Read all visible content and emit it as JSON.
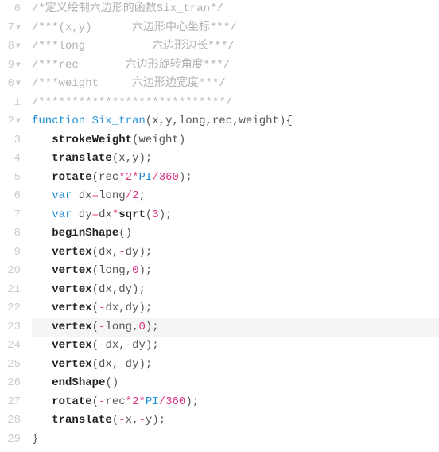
{
  "gutter": {
    "lines": [
      "6",
      "7",
      "8",
      "9",
      "0",
      "1",
      "2",
      "3",
      "4",
      "5",
      "6",
      "7",
      "8",
      "9",
      "20",
      "21",
      "22",
      "23",
      "24",
      "25",
      "26",
      "27",
      "28",
      "29"
    ],
    "foldable": [
      1,
      2,
      3,
      4,
      6
    ]
  },
  "code": {
    "lines": [
      {
        "tokens": [
          {
            "t": "comment",
            "v": "/*定义绘制六边形的函数Six_tran*/"
          }
        ]
      },
      {
        "tokens": [
          {
            "t": "comment",
            "v": "/***(x,y)      六边形中心坐标***/"
          }
        ]
      },
      {
        "tokens": [
          {
            "t": "comment",
            "v": "/***long          六边形边长***/"
          }
        ]
      },
      {
        "tokens": [
          {
            "t": "comment",
            "v": "/***rec       六边形旋转角度***/"
          }
        ]
      },
      {
        "tokens": [
          {
            "t": "comment",
            "v": "/***weight     六边形边宽度***/"
          }
        ]
      },
      {
        "tokens": [
          {
            "t": "comment",
            "v": "/****************************/"
          }
        ]
      },
      {
        "tokens": [
          {
            "t": "keyword",
            "v": "function"
          },
          {
            "t": "plain",
            "v": " "
          },
          {
            "t": "funcname",
            "v": "Six_tran"
          },
          {
            "t": "paren",
            "v": "("
          },
          {
            "t": "var",
            "v": "x"
          },
          {
            "t": "plain",
            "v": ","
          },
          {
            "t": "var",
            "v": "y"
          },
          {
            "t": "plain",
            "v": ","
          },
          {
            "t": "var",
            "v": "long"
          },
          {
            "t": "plain",
            "v": ","
          },
          {
            "t": "var",
            "v": "rec"
          },
          {
            "t": "plain",
            "v": ","
          },
          {
            "t": "var",
            "v": "weight"
          },
          {
            "t": "paren",
            "v": ")"
          },
          {
            "t": "brace",
            "v": "{"
          }
        ]
      },
      {
        "indent": 1,
        "tokens": [
          {
            "t": "funccall",
            "v": "strokeWeight"
          },
          {
            "t": "paren",
            "v": "("
          },
          {
            "t": "var",
            "v": "weight"
          },
          {
            "t": "paren",
            "v": ")"
          }
        ]
      },
      {
        "indent": 1,
        "tokens": [
          {
            "t": "funccall",
            "v": "translate"
          },
          {
            "t": "paren",
            "v": "("
          },
          {
            "t": "var",
            "v": "x"
          },
          {
            "t": "plain",
            "v": ","
          },
          {
            "t": "var",
            "v": "y"
          },
          {
            "t": "paren",
            "v": ")"
          },
          {
            "t": "plain",
            "v": ";"
          }
        ]
      },
      {
        "indent": 1,
        "tokens": [
          {
            "t": "funccall",
            "v": "rotate"
          },
          {
            "t": "paren",
            "v": "("
          },
          {
            "t": "var",
            "v": "rec"
          },
          {
            "t": "operator",
            "v": "*"
          },
          {
            "t": "number",
            "v": "2"
          },
          {
            "t": "operator",
            "v": "*"
          },
          {
            "t": "const",
            "v": "PI"
          },
          {
            "t": "operator",
            "v": "/"
          },
          {
            "t": "number",
            "v": "360"
          },
          {
            "t": "paren",
            "v": ")"
          },
          {
            "t": "plain",
            "v": ";"
          }
        ]
      },
      {
        "indent": 1,
        "tokens": [
          {
            "t": "keyword",
            "v": "var"
          },
          {
            "t": "plain",
            "v": " "
          },
          {
            "t": "var",
            "v": "dx"
          },
          {
            "t": "operator",
            "v": "="
          },
          {
            "t": "var",
            "v": "long"
          },
          {
            "t": "operator",
            "v": "/"
          },
          {
            "t": "number",
            "v": "2"
          },
          {
            "t": "plain",
            "v": ";"
          }
        ]
      },
      {
        "indent": 1,
        "tokens": [
          {
            "t": "keyword",
            "v": "var"
          },
          {
            "t": "plain",
            "v": " "
          },
          {
            "t": "var",
            "v": "dy"
          },
          {
            "t": "operator",
            "v": "="
          },
          {
            "t": "var",
            "v": "dx"
          },
          {
            "t": "operator",
            "v": "*"
          },
          {
            "t": "funccall",
            "v": "sqrt"
          },
          {
            "t": "paren",
            "v": "("
          },
          {
            "t": "number",
            "v": "3"
          },
          {
            "t": "paren",
            "v": ")"
          },
          {
            "t": "plain",
            "v": ";"
          }
        ]
      },
      {
        "indent": 1,
        "tokens": [
          {
            "t": "funccall",
            "v": "beginShape"
          },
          {
            "t": "paren",
            "v": "()"
          }
        ]
      },
      {
        "indent": 1,
        "tokens": [
          {
            "t": "funccall",
            "v": "vertex"
          },
          {
            "t": "paren",
            "v": "("
          },
          {
            "t": "var",
            "v": "dx"
          },
          {
            "t": "plain",
            "v": ","
          },
          {
            "t": "operator",
            "v": "-"
          },
          {
            "t": "var",
            "v": "dy"
          },
          {
            "t": "paren",
            "v": ")"
          },
          {
            "t": "plain",
            "v": ";"
          }
        ]
      },
      {
        "indent": 1,
        "tokens": [
          {
            "t": "funccall",
            "v": "vertex"
          },
          {
            "t": "paren",
            "v": "("
          },
          {
            "t": "var",
            "v": "long"
          },
          {
            "t": "plain",
            "v": ","
          },
          {
            "t": "number",
            "v": "0"
          },
          {
            "t": "paren",
            "v": ")"
          },
          {
            "t": "plain",
            "v": ";"
          }
        ]
      },
      {
        "indent": 1,
        "tokens": [
          {
            "t": "funccall",
            "v": "vertex"
          },
          {
            "t": "paren",
            "v": "("
          },
          {
            "t": "var",
            "v": "dx"
          },
          {
            "t": "plain",
            "v": ","
          },
          {
            "t": "var",
            "v": "dy"
          },
          {
            "t": "paren",
            "v": ")"
          },
          {
            "t": "plain",
            "v": ";"
          }
        ]
      },
      {
        "indent": 1,
        "tokens": [
          {
            "t": "funccall",
            "v": "vertex"
          },
          {
            "t": "paren",
            "v": "("
          },
          {
            "t": "operator",
            "v": "-"
          },
          {
            "t": "var",
            "v": "dx"
          },
          {
            "t": "plain",
            "v": ","
          },
          {
            "t": "var",
            "v": "dy"
          },
          {
            "t": "paren",
            "v": ")"
          },
          {
            "t": "plain",
            "v": ";"
          }
        ]
      },
      {
        "indent": 1,
        "highlighted": true,
        "tokens": [
          {
            "t": "funccall",
            "v": "vertex"
          },
          {
            "t": "paren",
            "v": "("
          },
          {
            "t": "operator",
            "v": "-"
          },
          {
            "t": "var",
            "v": "long"
          },
          {
            "t": "plain",
            "v": ","
          },
          {
            "t": "number",
            "v": "0"
          },
          {
            "t": "paren",
            "v": ")"
          },
          {
            "t": "plain",
            "v": ";"
          }
        ]
      },
      {
        "indent": 1,
        "tokens": [
          {
            "t": "funccall",
            "v": "vertex"
          },
          {
            "t": "paren",
            "v": "("
          },
          {
            "t": "operator",
            "v": "-"
          },
          {
            "t": "var",
            "v": "dx"
          },
          {
            "t": "plain",
            "v": ","
          },
          {
            "t": "operator",
            "v": "-"
          },
          {
            "t": "var",
            "v": "dy"
          },
          {
            "t": "paren",
            "v": ")"
          },
          {
            "t": "plain",
            "v": ";"
          }
        ]
      },
      {
        "indent": 1,
        "tokens": [
          {
            "t": "funccall",
            "v": "vertex"
          },
          {
            "t": "paren",
            "v": "("
          },
          {
            "t": "var",
            "v": "dx"
          },
          {
            "t": "plain",
            "v": ","
          },
          {
            "t": "operator",
            "v": "-"
          },
          {
            "t": "var",
            "v": "dy"
          },
          {
            "t": "paren",
            "v": ")"
          },
          {
            "t": "plain",
            "v": ";"
          }
        ]
      },
      {
        "indent": 1,
        "tokens": [
          {
            "t": "funccall",
            "v": "endShape"
          },
          {
            "t": "paren",
            "v": "()"
          }
        ]
      },
      {
        "indent": 1,
        "tokens": [
          {
            "t": "funccall",
            "v": "rotate"
          },
          {
            "t": "paren",
            "v": "("
          },
          {
            "t": "operator",
            "v": "-"
          },
          {
            "t": "var",
            "v": "rec"
          },
          {
            "t": "operator",
            "v": "*"
          },
          {
            "t": "number",
            "v": "2"
          },
          {
            "t": "operator",
            "v": "*"
          },
          {
            "t": "const",
            "v": "PI"
          },
          {
            "t": "operator",
            "v": "/"
          },
          {
            "t": "number",
            "v": "360"
          },
          {
            "t": "paren",
            "v": ")"
          },
          {
            "t": "plain",
            "v": ";"
          }
        ]
      },
      {
        "indent": 1,
        "tokens": [
          {
            "t": "funccall",
            "v": "translate"
          },
          {
            "t": "paren",
            "v": "("
          },
          {
            "t": "operator",
            "v": "-"
          },
          {
            "t": "var",
            "v": "x"
          },
          {
            "t": "plain",
            "v": ","
          },
          {
            "t": "operator",
            "v": "-"
          },
          {
            "t": "var",
            "v": "y"
          },
          {
            "t": "paren",
            "v": ")"
          },
          {
            "t": "plain",
            "v": ";"
          }
        ]
      },
      {
        "tokens": [
          {
            "t": "brace",
            "v": "}"
          }
        ]
      }
    ]
  }
}
